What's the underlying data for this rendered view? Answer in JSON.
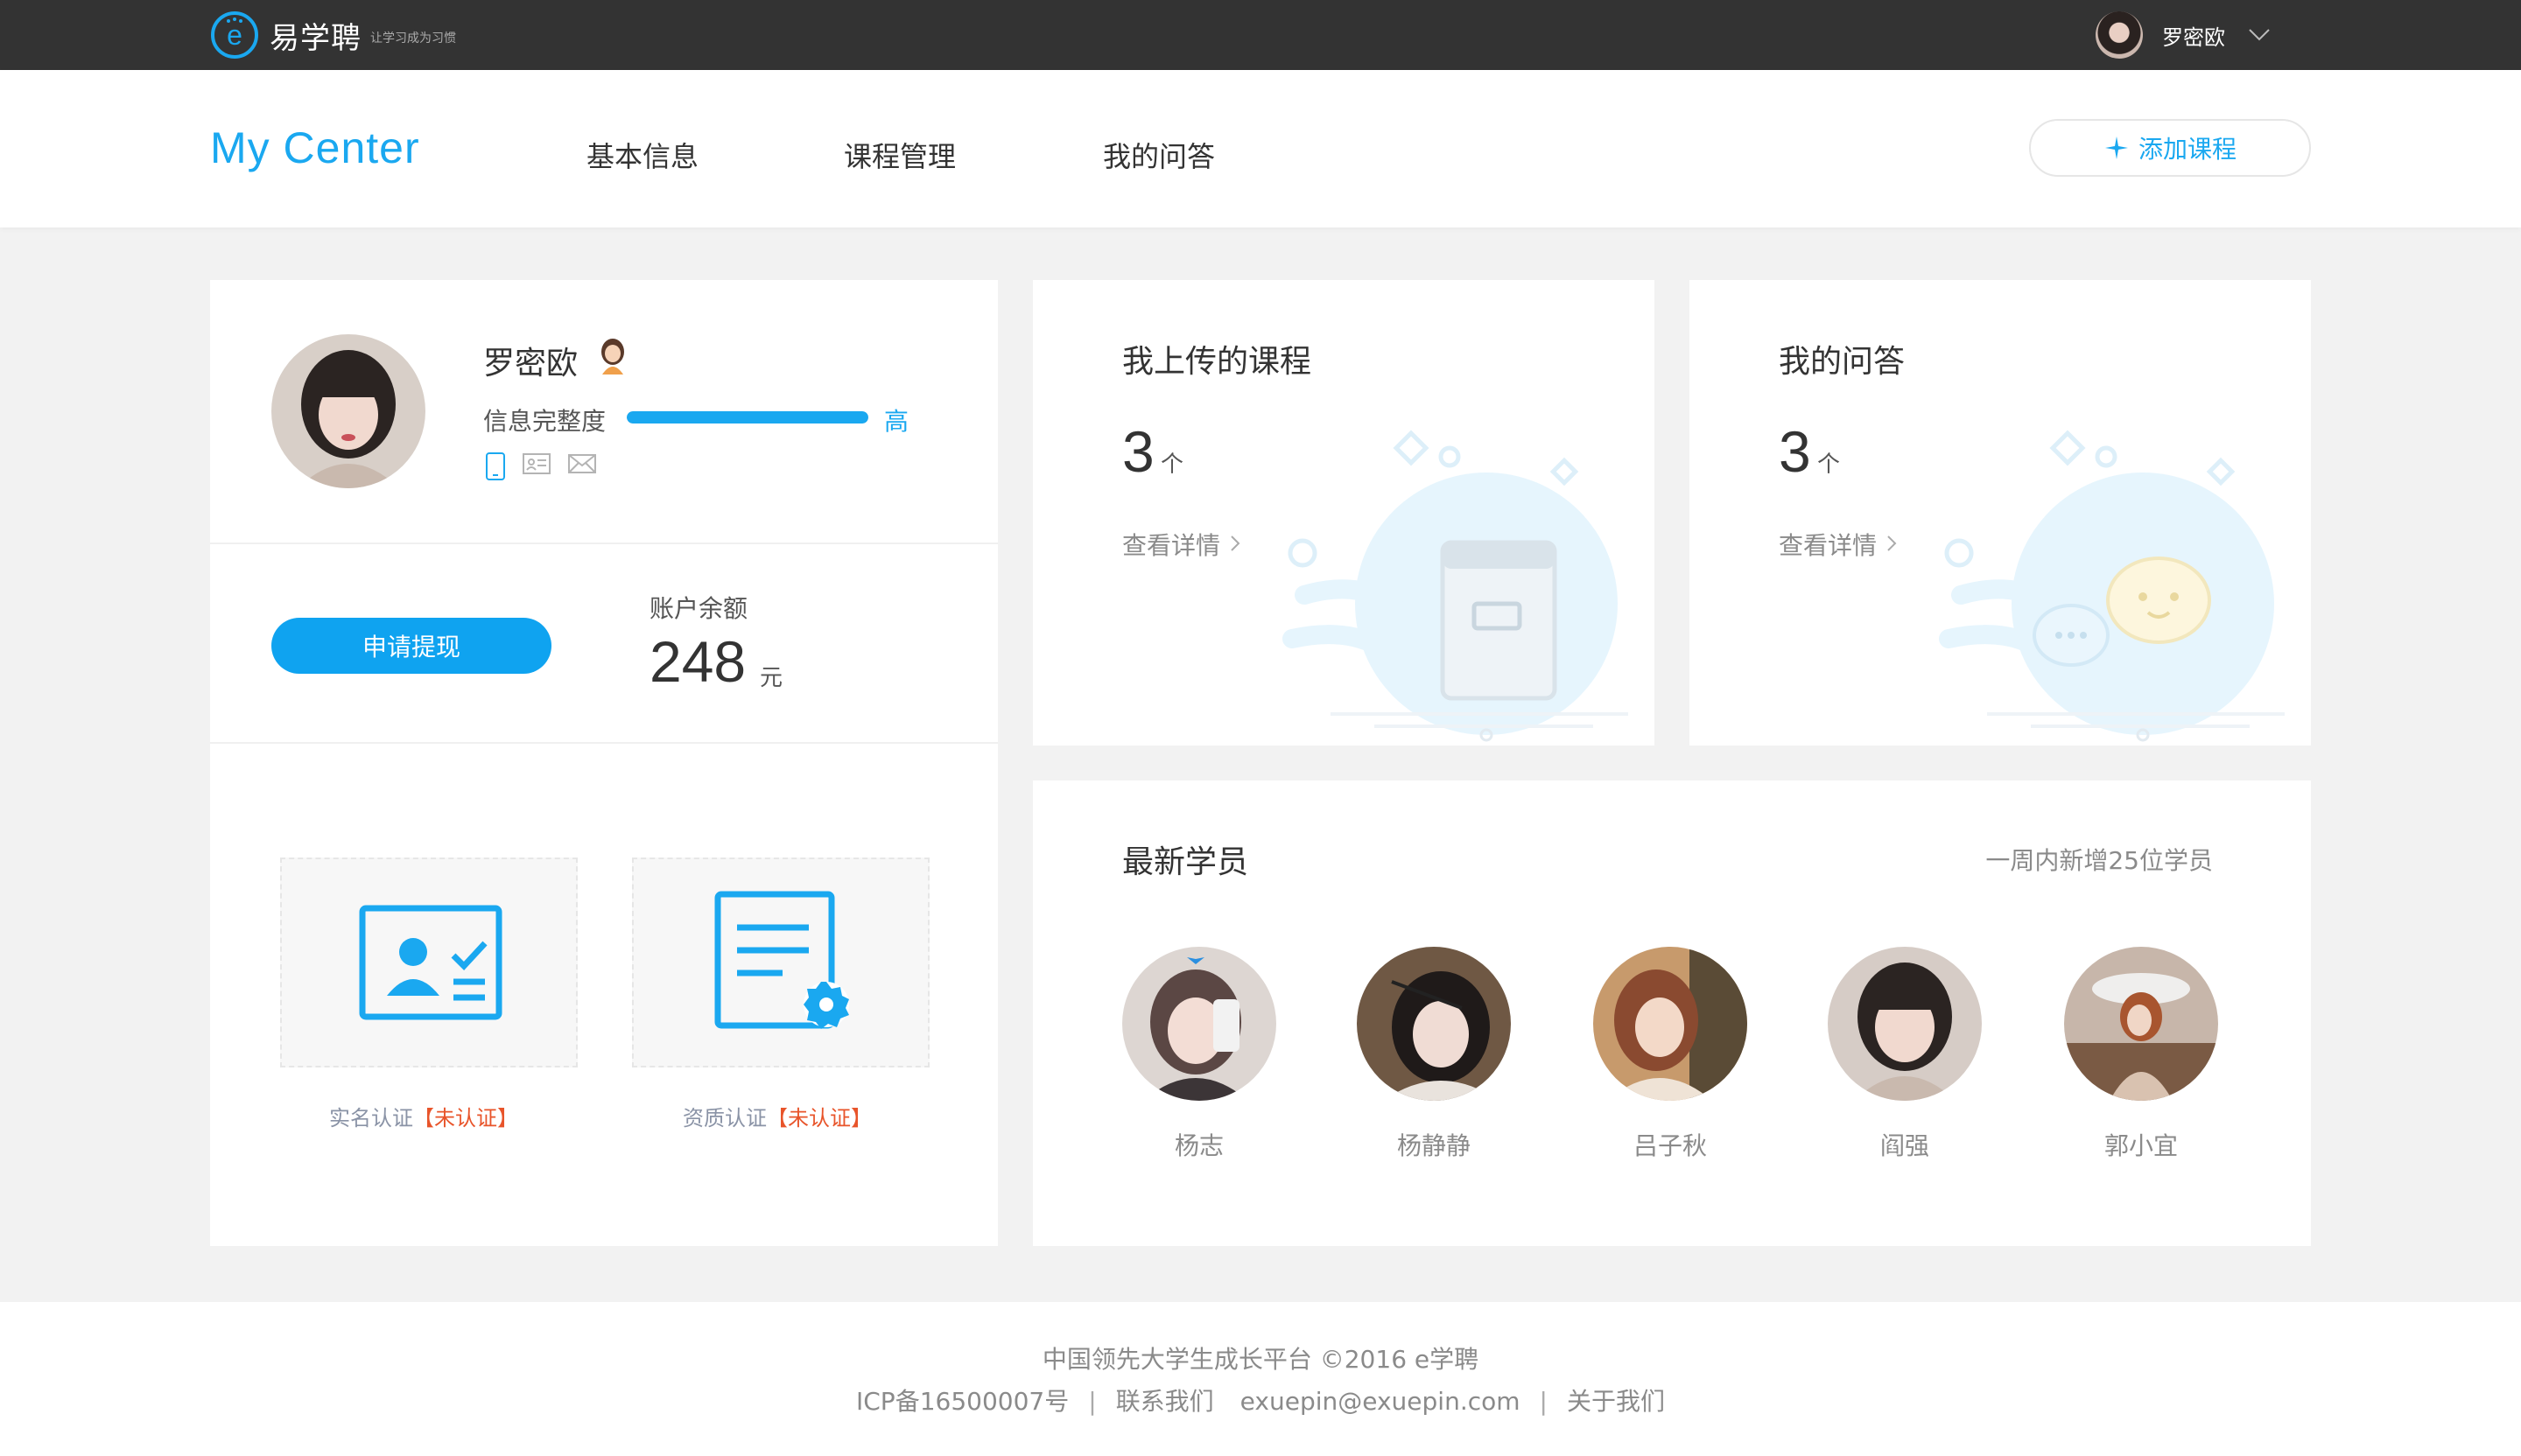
{
  "topbar": {
    "logo_text": "易学聘",
    "logo_slogan": "让学习成为习惯",
    "username": "罗密欧"
  },
  "nav": {
    "title": "My Center",
    "tabs": [
      "基本信息",
      "课程管理",
      "我的问答"
    ],
    "add_course": "添加课程"
  },
  "profile": {
    "name": "罗密欧",
    "completeness_label": "信息完整度",
    "completeness_level": "高",
    "completeness_fraction": 1.0,
    "withdraw_button": "申请提现",
    "balance_label": "账户余额",
    "balance_value": "248",
    "balance_unit": "元",
    "certs": [
      {
        "label": "实名认证",
        "status": "【未认证】"
      },
      {
        "label": "资质认证",
        "status": "【未认证】"
      }
    ]
  },
  "uploaded_courses": {
    "title": "我上传的课程",
    "count": "3",
    "unit": "个",
    "link": "查看详情"
  },
  "my_qa": {
    "title": "我的问答",
    "count": "3",
    "unit": "个",
    "link": "查看详情"
  },
  "students": {
    "title": "最新学员",
    "note": "一周内新增25位学员",
    "list": [
      {
        "name": "杨志"
      },
      {
        "name": "杨静静"
      },
      {
        "name": "吕子秋"
      },
      {
        "name": "阎强"
      },
      {
        "name": "郭小宜"
      }
    ]
  },
  "footer": {
    "line1": "中国领先大学生成长平台  ©2016  e学聘",
    "icp": "ICP备16500007号",
    "contact": "联系我们",
    "email": "exuepin@exuepin.com",
    "about": "关于我们"
  },
  "colors": {
    "accent": "#1aa8f0",
    "topbar": "#333333",
    "warning": "#e8542a",
    "background": "#f2f2f2"
  },
  "icons": [
    "logo-e-icon",
    "chevron-down-icon",
    "plus-icon",
    "female-avatar-icon",
    "phone-icon",
    "id-card-icon",
    "mail-icon",
    "id-verify-icon",
    "certificate-icon",
    "chevron-right-icon",
    "book-illustration",
    "chat-illustration"
  ]
}
